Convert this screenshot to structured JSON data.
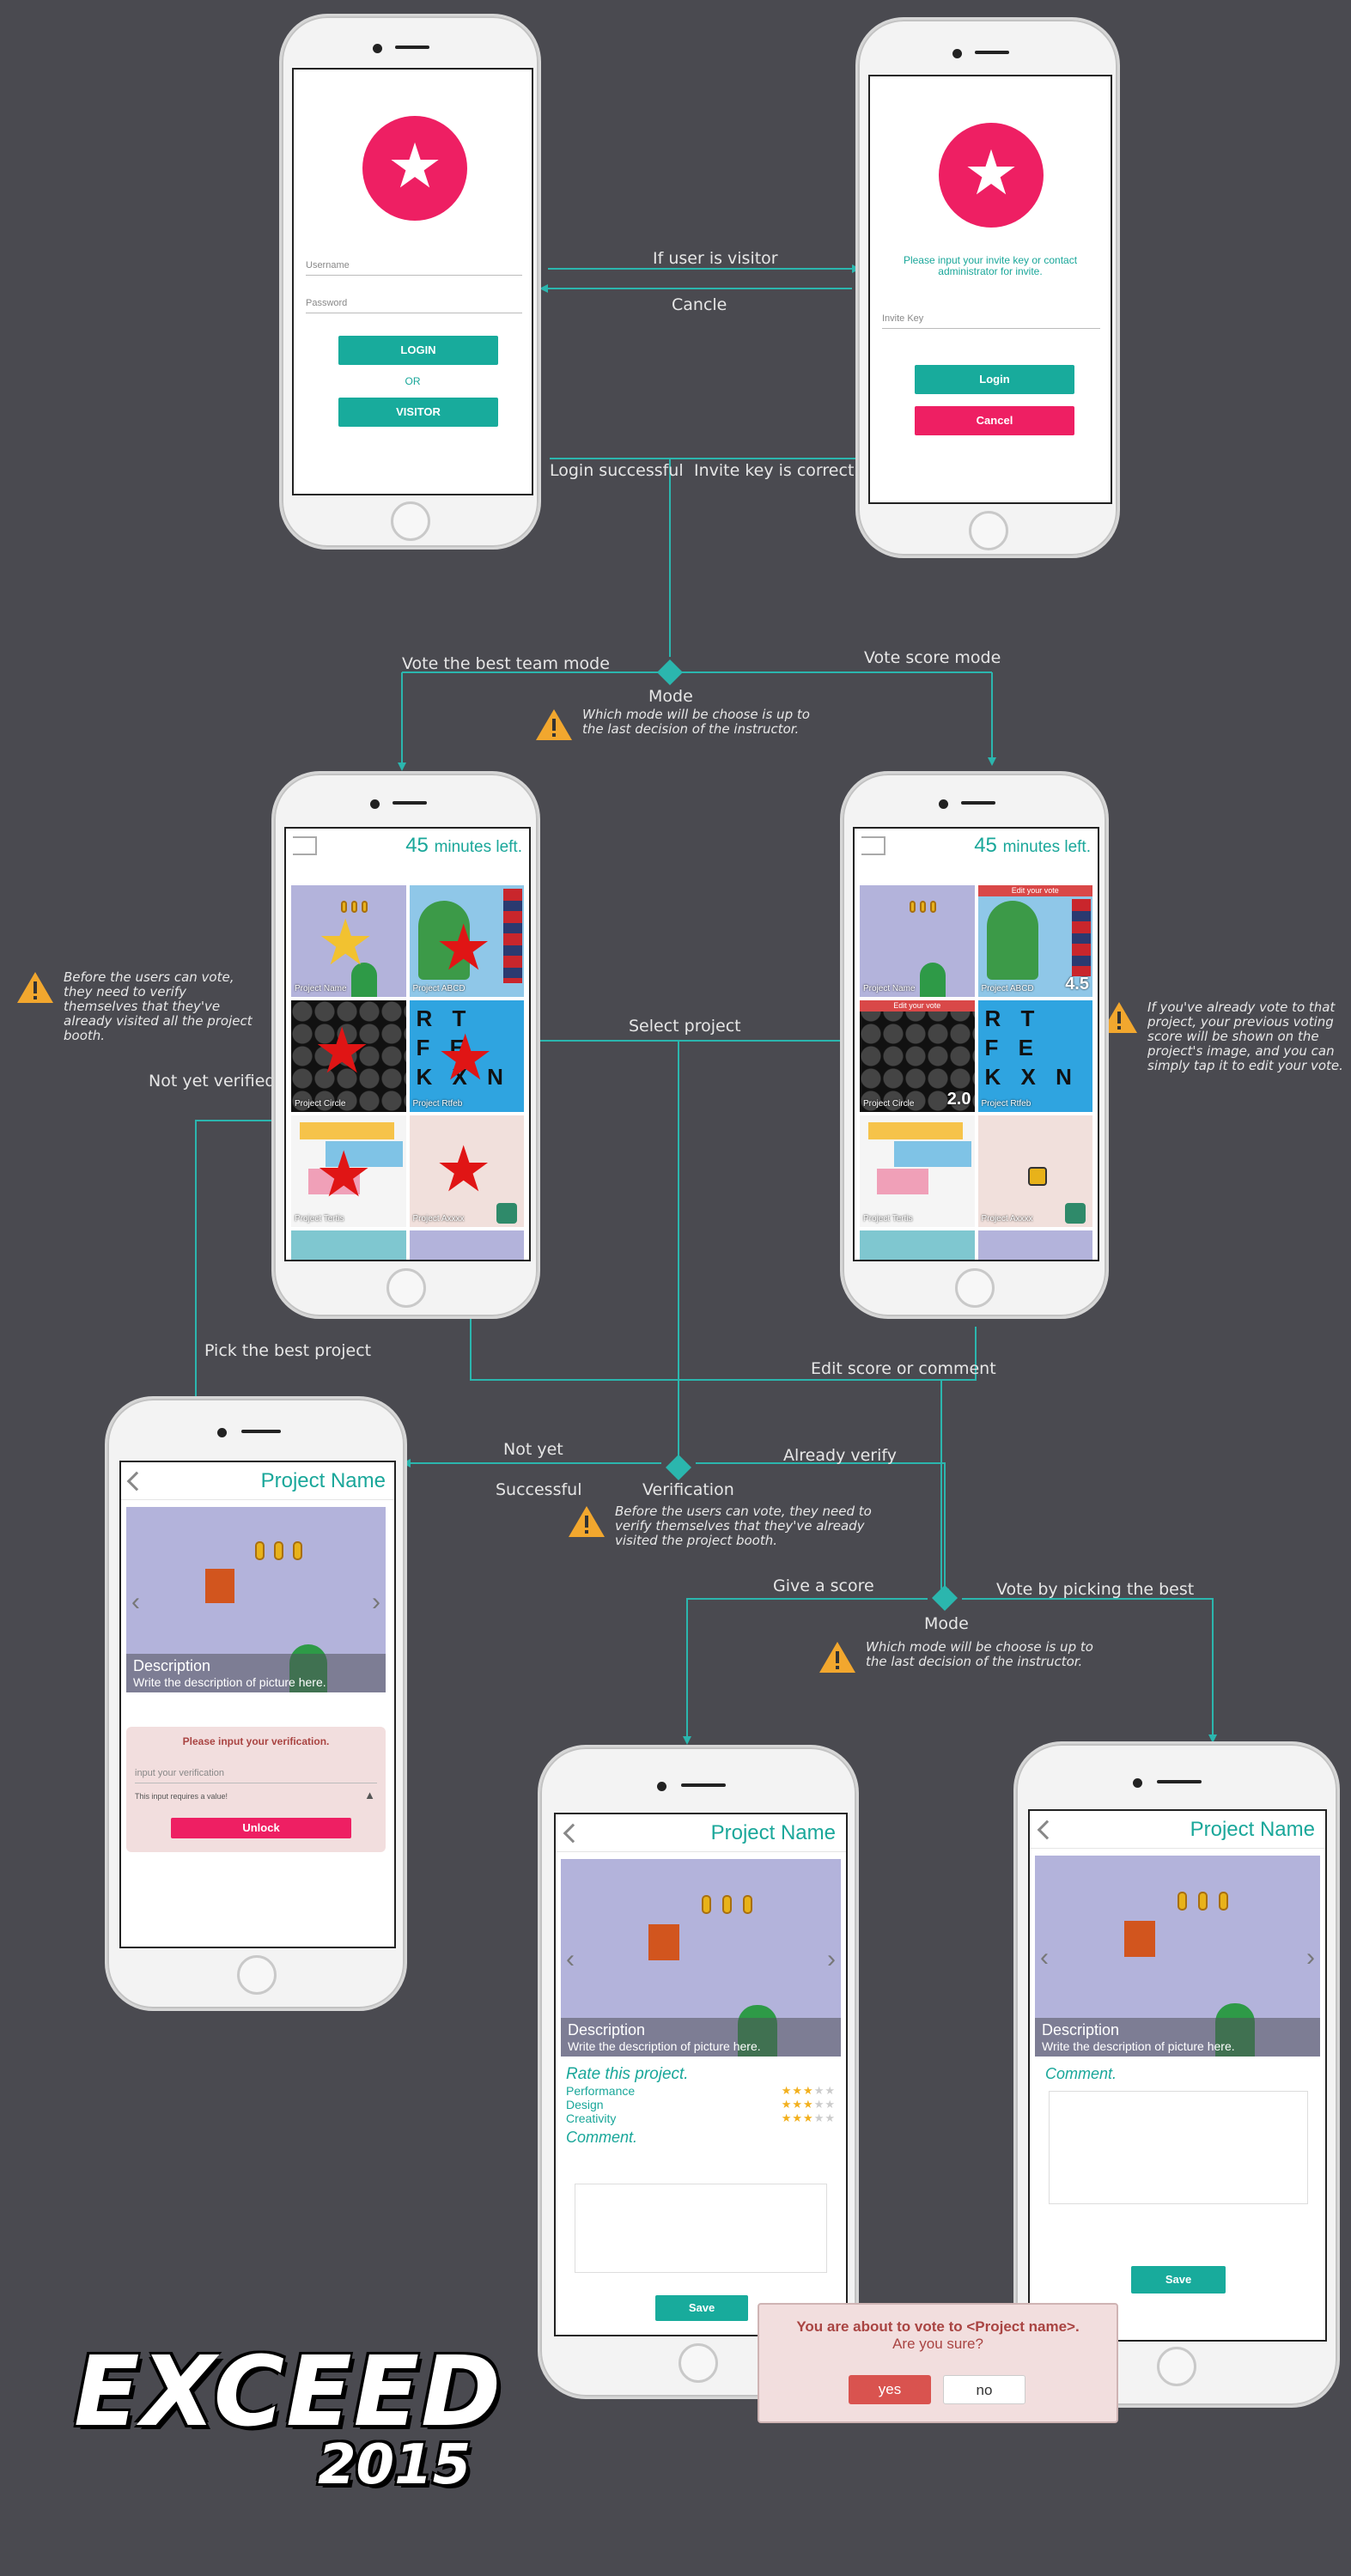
{
  "flow_labels": {
    "if_user_is_visitor": "If user is visitor",
    "cancle": "Cancle",
    "login_successful": "Login successful",
    "invite_key_correct": "Invite key is correct",
    "vote_best_team_mode": "Vote the best team mode",
    "vote_score_mode": "Vote score mode",
    "mode": "Mode",
    "select_project": "Select project",
    "not_yet_verified": "Not yet verified",
    "pick_best_project": "Pick the best project",
    "edit_score_or_comment": "Edit score or comment",
    "not_yet": "Not yet",
    "successful": "Successful",
    "verification": "Verification",
    "already_verify": "Already verify",
    "give_a_score": "Give a score",
    "vote_by_picking_best": "Vote by picking the best",
    "mode_2": "Mode"
  },
  "notes": {
    "mode_note": "Which mode will be choose is up to the last decision of the instructor.",
    "verify_note_left": "Before the users can vote, they need to verify themselves that they've already visited all the project booth.",
    "already_voted_note": "If you've already vote to that project, your previous voting score will be shown on the project's image, and you can simply tap it to edit your vote.",
    "verify_note_center": "Before the users can vote, they need to verify themselves that they've already visited the project booth.",
    "mode_note_2": "Which mode will be choose is up to the last decision of the instructor."
  },
  "login_screen": {
    "username_placeholder": "Username",
    "password_placeholder": "Password",
    "login_button": "LOGIN",
    "or_text": "OR",
    "visitor_button": "VISITOR"
  },
  "invite_screen": {
    "message": "Please input your invite key or contact administrator for invite.",
    "invite_key_placeholder": "Invite Key",
    "login_button": "Login",
    "cancel_button": "Cancel"
  },
  "project_list": {
    "time_value": "45",
    "time_suffix": "minutes left.",
    "edit_vote_label": "Edit your vote",
    "projects": [
      {
        "name": "Project Name",
        "score": ""
      },
      {
        "name": "Project ABCD",
        "score": "4.5"
      },
      {
        "name": "Project Circle",
        "score": "2.0"
      },
      {
        "name": "Project Rtfeb",
        "score": ""
      },
      {
        "name": "Project Tertis",
        "score": ""
      },
      {
        "name": "Project Axxxx",
        "score": ""
      }
    ]
  },
  "project_detail": {
    "title": "Project Name",
    "description_title": "Description",
    "description_text": "Write the description of picture here.",
    "verification_prompt": "Please input your verification.",
    "verification_placeholder": "input your verification",
    "verification_error": "This input requires a value!",
    "unlock_button": "Unlock"
  },
  "rating_screen": {
    "title": "Project Name",
    "rate_heading": "Rate this project.",
    "criteria": [
      {
        "label": "Performance",
        "stars": 3,
        "max": 5
      },
      {
        "label": "Design",
        "stars": 3,
        "max": 5
      },
      {
        "label": "Creativity",
        "stars": 3,
        "max": 5
      }
    ],
    "comment_heading": "Comment.",
    "save_button": "Save"
  },
  "comment_screen": {
    "title": "Project Name",
    "comment_heading": "Comment.",
    "save_button": "Save"
  },
  "confirm_dialog": {
    "message": "You are about to vote to <Project name>.",
    "question": "Are you sure?",
    "yes_button": "yes",
    "no_button": "no"
  },
  "logo": {
    "line1": "EXCEED",
    "line2": "2015"
  },
  "colors": {
    "background": "#4a4a50",
    "teal": "#1aa79a",
    "pink": "#ee1f63",
    "flow_line": "#2bb6ae"
  }
}
